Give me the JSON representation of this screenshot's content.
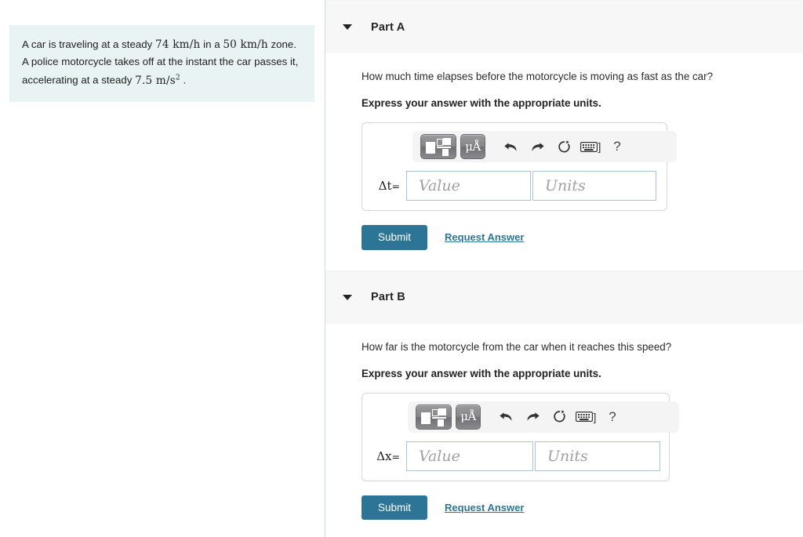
{
  "problem": {
    "text_1": "A car is traveling at a steady ",
    "val_1": "74 km/h",
    "text_2": " in a ",
    "val_2": "50 km/h",
    "text_3": " zone. A police motorcycle takes off at the instant the car passes it, accelerating at a steady ",
    "val_3": "7.5 m/s",
    "val_3_sup": "2",
    "text_4": " ."
  },
  "parts": [
    {
      "title": "Part A",
      "question": "How much time elapses before the motorcycle is moving as fast as the car?",
      "instruction": "Express your answer with the appropriate units.",
      "variable": "Δt",
      "equals": "=",
      "value_placeholder": "Value",
      "units_placeholder": "Units",
      "value": "",
      "units": "",
      "submit_label": "Submit",
      "request_label": "Request Answer"
    },
    {
      "title": "Part B",
      "question": "How far is the motorcycle from the car when it reaches this speed?",
      "instruction": "Express your answer with the appropriate units.",
      "variable": "Δx",
      "equals": "=",
      "value_placeholder": "Value",
      "units_placeholder": "Units",
      "value": "",
      "units": "",
      "submit_label": "Submit",
      "request_label": "Request Answer"
    }
  ],
  "toolbar": {
    "template_icon": "math-template-icon",
    "units_label": "μÅ",
    "undo_icon": "undo-arrow-icon",
    "redo_icon": "redo-arrow-icon",
    "reset_icon": "reset-circular-arrow-icon",
    "keyboard_icon": "keyboard-icon",
    "keyboard_bracket": "]",
    "help_label": "?"
  },
  "colors": {
    "accent": "#2d7596",
    "problem_bg": "#e9f3f3",
    "header_bg": "#f7f7f7",
    "field_border": "#a9c3d4",
    "divider": "#cdd9e3"
  }
}
